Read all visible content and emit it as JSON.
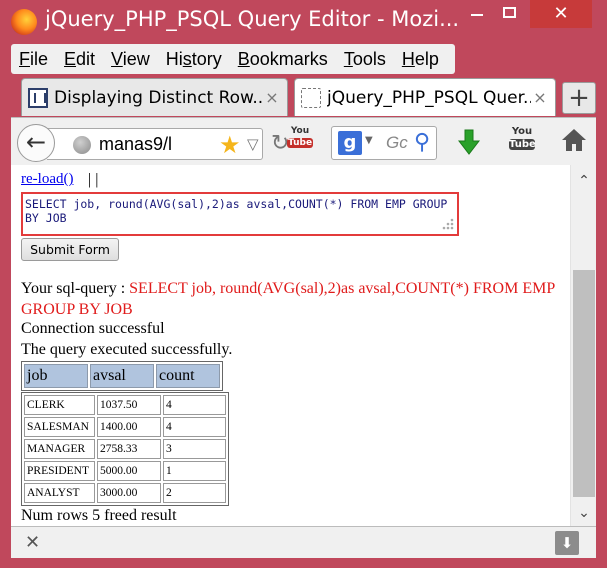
{
  "window": {
    "title": "jQuery_PHP_PSQL Query Editor - Mozi...",
    "minimize_icon": "minimize-icon",
    "maximize_icon": "maximize-icon",
    "close_glyph": "✕"
  },
  "menu": {
    "items": [
      {
        "key": "F",
        "rest": "ile"
      },
      {
        "key": "E",
        "rest": "dit"
      },
      {
        "key": "V",
        "rest": "iew"
      },
      {
        "pre": "Hi",
        "key": "s",
        "rest": "tory"
      },
      {
        "key": "B",
        "rest": "ookmarks"
      },
      {
        "key": "T",
        "rest": "ools"
      },
      {
        "key": "H",
        "rest": "elp"
      }
    ]
  },
  "tabs": [
    {
      "label": "Displaying Distinct Row...",
      "close": "×"
    },
    {
      "label": "jQuery_PHP_PSQL Quer...",
      "close": "×"
    }
  ],
  "new_tab_label": "+",
  "navbar": {
    "back_glyph": "←",
    "url": "manas9/l",
    "search_engine_letter": "g",
    "search_placeholder": "Gc",
    "youtube_small_top": "You",
    "youtube_small_bottom": "Tube",
    "youtube_top": "You",
    "youtube_bottom": "Tube"
  },
  "content": {
    "reload_link": "re-load()",
    "pipes": "| |",
    "query_text": "SELECT job, round(AVG(sal),2)as avsal,COUNT(*) FROM EMP GROUP BY JOB",
    "submit_label": "Submit Form",
    "sql_prefix": "Your sql-query : ",
    "sql_echo": "SELECT job, round(AVG(sal),2)as avsal,COUNT(*) FROM EMP GROUP BY JOB",
    "connection_msg": "Connection successful",
    "executed_msg": "The query executed successfully.",
    "columns": [
      "job",
      "avsal",
      "count"
    ],
    "rows": [
      [
        "CLERK",
        "1037.50",
        "4"
      ],
      [
        "SALESMAN",
        "1400.00",
        "4"
      ],
      [
        "MANAGER",
        "2758.33",
        "3"
      ],
      [
        "PRESIDENT",
        "5000.00",
        "1"
      ],
      [
        "ANALYST",
        "3000.00",
        "2"
      ]
    ],
    "footer_msg": "Num rows 5 freed result"
  },
  "colors": {
    "window_frame": "#c0485c",
    "header_cell": "#b0c4de",
    "query_border": "#e33b3b",
    "sql_text": "#e01b1b",
    "link": "#0000ee"
  }
}
